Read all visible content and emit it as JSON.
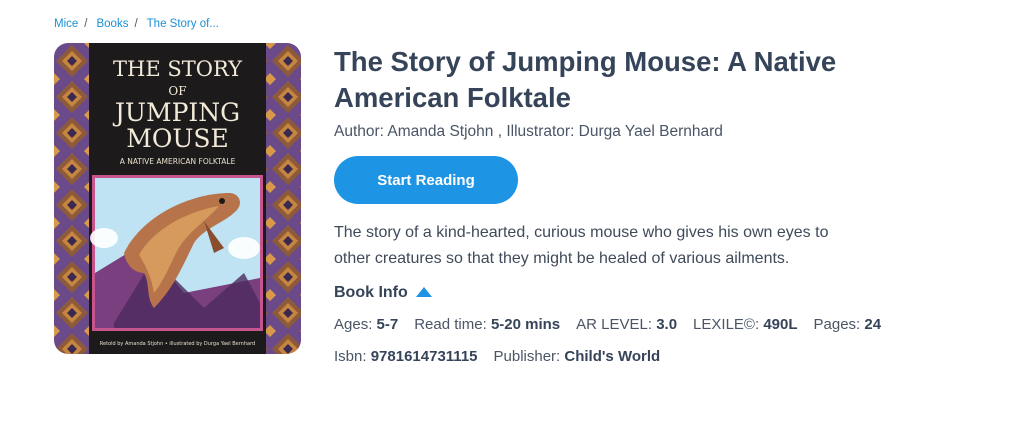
{
  "breadcrumb": {
    "items": [
      "Mice",
      "Books",
      "The Story of..."
    ],
    "separator": "/"
  },
  "book": {
    "title": "The Story of Jumping Mouse: A Native American Folktale",
    "author_line": "Author: Amanda Stjohn , Illustrator: Durga Yael Bernhard",
    "description": "The story of a kind-hearted, curious mouse who gives his own eyes to other creatures so that they might be healed of various ailments.",
    "cover": {
      "title_line1": "THE STORY",
      "title_line2": "OF",
      "title_line3": "JUMPING",
      "title_line4": "MOUSE",
      "subtitle": "A NATIVE AMERICAN FOLKTALE",
      "credits": "Retold by Amanda Stjohn • illustrated by Durga Yael Bernhard"
    }
  },
  "actions": {
    "start_reading": "Start Reading",
    "book_info": "Book Info"
  },
  "info": {
    "ages_label": "Ages:",
    "ages": "5-7",
    "read_time_label": "Read time:",
    "read_time": "5-20 mins",
    "ar_label": "AR LEVEL:",
    "ar": "3.0",
    "lexile_label": "LEXILE©:",
    "lexile": "490L",
    "pages_label": "Pages:",
    "pages": "24",
    "isbn_label": "Isbn:",
    "isbn": "9781614731115",
    "publisher_label": "Publisher:",
    "publisher": "Child's World"
  },
  "colors": {
    "accent": "#1e95e4",
    "link": "#1a8fd6",
    "heading": "#364459"
  }
}
